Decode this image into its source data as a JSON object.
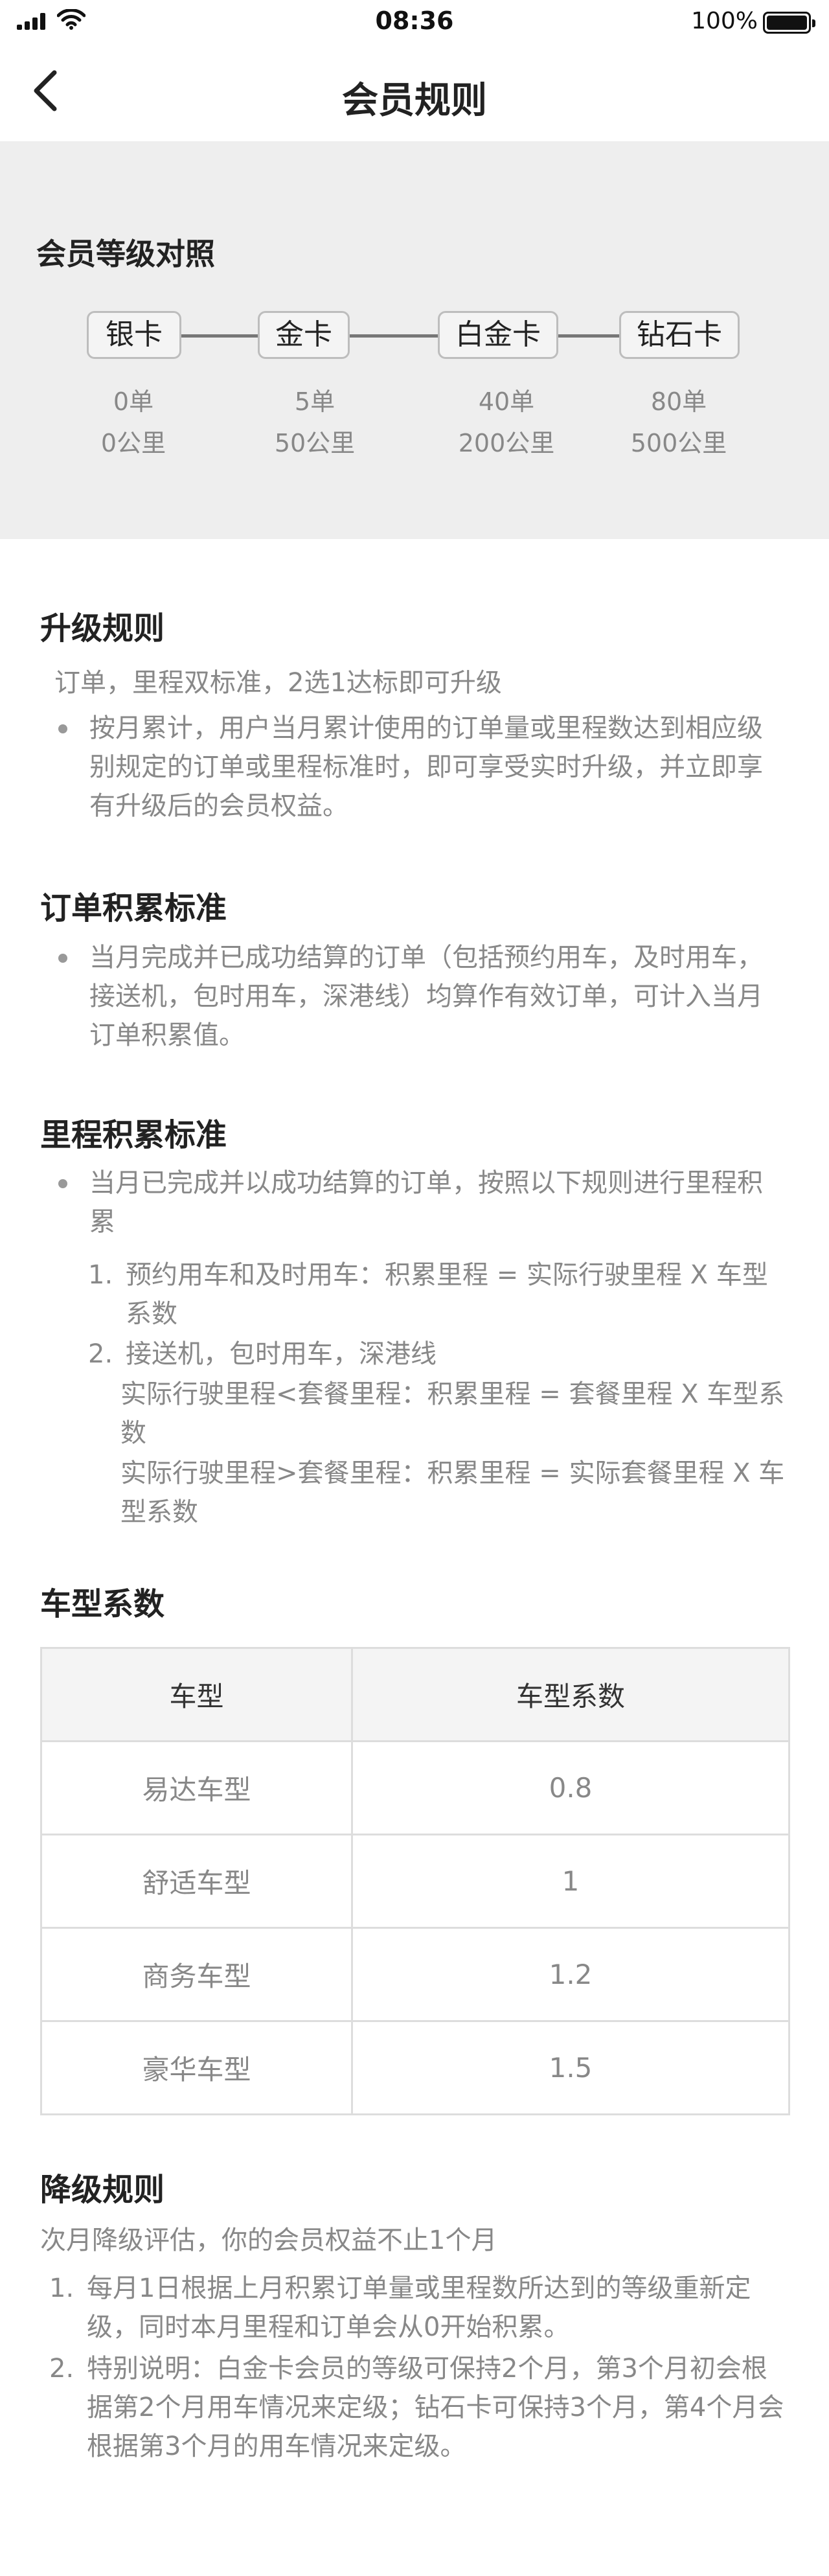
{
  "status_bar": {
    "time": "08:36",
    "battery": "100%"
  },
  "nav": {
    "title": "会员规则"
  },
  "levels": {
    "title": "会员等级对照",
    "items": [
      {
        "name": "银卡",
        "orders": "0单",
        "mileage": "0公里"
      },
      {
        "name": "金卡",
        "orders": "5单",
        "mileage": "50公里"
      },
      {
        "name": "白金卡",
        "orders": "40单",
        "mileage": "200公里"
      },
      {
        "name": "钻石卡",
        "orders": "80单",
        "mileage": "500公里"
      }
    ]
  },
  "upgrade": {
    "title": "升级规则",
    "intro": "订单，里程双标准，2选1达标即可升级",
    "bullet": "按月累计，用户当月累计使用的订单量或里程数达到相应级别规定的订单或里程标准时，即可享受实时升级，并立即享有升级后的会员权益。"
  },
  "order_standard": {
    "title": "订单积累标准",
    "bullet": "当月完成并已成功结算的订单（包括预约用车，及时用车，接送机，包时用车，深港线）均算作有效订单，可计入当月订单积累值。"
  },
  "mileage_standard": {
    "title": "里程积累标准",
    "bullet": "当月已完成并以成功结算的订单，按照以下规则进行里程积累",
    "rules": [
      {
        "n": "1.",
        "text": "预约用车和及时用车：积累里程 = 实际行驶里程 X 车型系数"
      },
      {
        "n": "2.",
        "text": "接送机，包时用车，深港线"
      }
    ],
    "sub_rules": [
      "实际行驶里程<套餐里程：积累里程 = 套餐里程 X 车型系数",
      "实际行驶里程>套餐里程：积累里程 = 实际套餐里程 X 车型系数"
    ]
  },
  "coefficient": {
    "title": "车型系数",
    "headers": [
      "车型",
      "车型系数"
    ],
    "rows": [
      [
        "易达车型",
        "0.8"
      ],
      [
        "舒适车型",
        "1"
      ],
      [
        "商务车型",
        "1.2"
      ],
      [
        "豪华车型",
        "1.5"
      ]
    ]
  },
  "downgrade": {
    "title": "降级规则",
    "intro": "次月降级评估，你的会员权益不止1个月",
    "items": [
      {
        "n": "1.",
        "text": "每月1日根据上月积累订单量或里程数所达到的等级重新定级，同时本月里程和订单会从0开始积累。"
      },
      {
        "n": "2.",
        "text": "特别说明：白金卡会员的等级可保持2个月，第3个月初会根据第2个月用车情况来定级；钻石卡可保持3个月，第4个月会根据第3个月的用车情况来定级。"
      }
    ]
  }
}
